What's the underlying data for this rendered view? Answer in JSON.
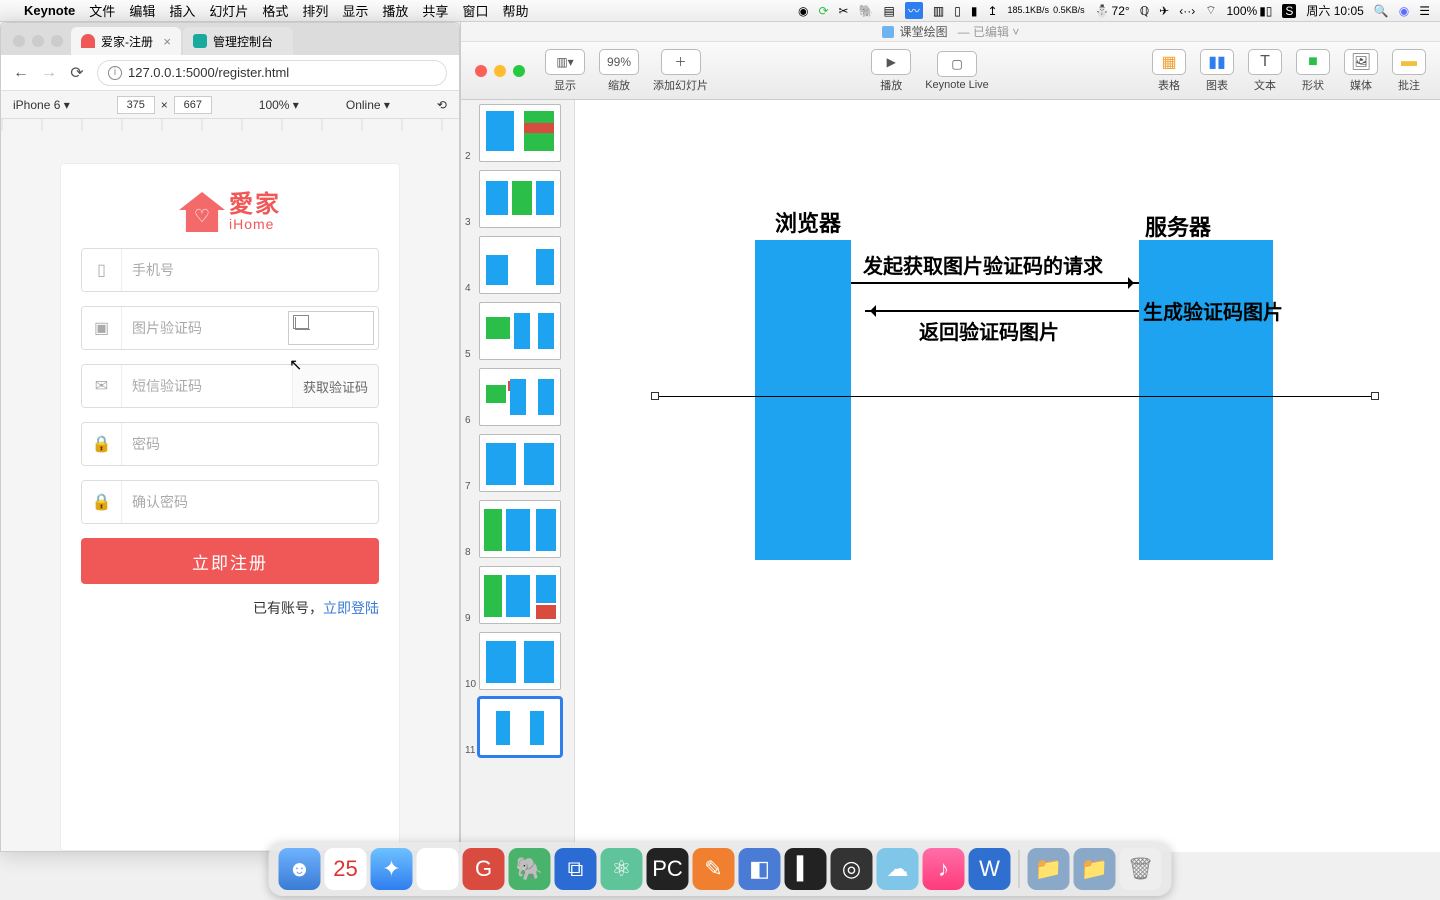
{
  "menubar": {
    "app": "Keynote",
    "items": [
      "文件",
      "编辑",
      "插入",
      "幻灯片",
      "格式",
      "排列",
      "显示",
      "播放",
      "共享",
      "窗口",
      "帮助"
    ],
    "net_up": "185.1KB/s",
    "net_down": "0.5KB/s",
    "temp": "72°",
    "battery": "100%",
    "clock": "周六 10:05"
  },
  "chrome": {
    "tabs": [
      {
        "title": "爱家-注册",
        "active": true
      },
      {
        "title": "管理控制台",
        "active": false
      }
    ],
    "url": "127.0.0.1:5000/register.html",
    "dev": {
      "device": "iPhone 6 ▾",
      "w": "375",
      "h": "667",
      "zoom": "100% ▾",
      "net": "Online ▾"
    }
  },
  "form": {
    "logo_cn": "愛家",
    "logo_en": "iHome",
    "phone": "手机号",
    "imgcode": "图片验证码",
    "smscode": "短信验证码",
    "getcode": "获取验证码",
    "pwd": "密码",
    "pwd2": "确认密码",
    "submit": "立即注册",
    "have": "已有账号，",
    "login": "立即登陆"
  },
  "keynote": {
    "doc": "课堂绘图",
    "edited": "— 已编辑 ˅",
    "toolbar": {
      "view": "显示",
      "zoom_val": "99%",
      "zoom": "缩放",
      "add": "添加幻灯片",
      "play": "播放",
      "live": "Keynote Live",
      "table": "表格",
      "chart": "图表",
      "text": "文本",
      "shape": "形状",
      "media": "媒体",
      "comment": "批注"
    },
    "thumbs": [
      2,
      3,
      4,
      5,
      6,
      7,
      8,
      9,
      10,
      11
    ],
    "selected": 11,
    "slide": {
      "browser": "浏览器",
      "server": "服务器",
      "req": "发起获取图片验证码的请求",
      "gen": "生成验证码图片",
      "resp": "返回验证码图片"
    }
  },
  "colors": {
    "accent": "#1ea3f0",
    "red": "#f05757",
    "green": "#2bbf4a",
    "orange": "#ffb129",
    "blue": "#2f7ef0"
  }
}
